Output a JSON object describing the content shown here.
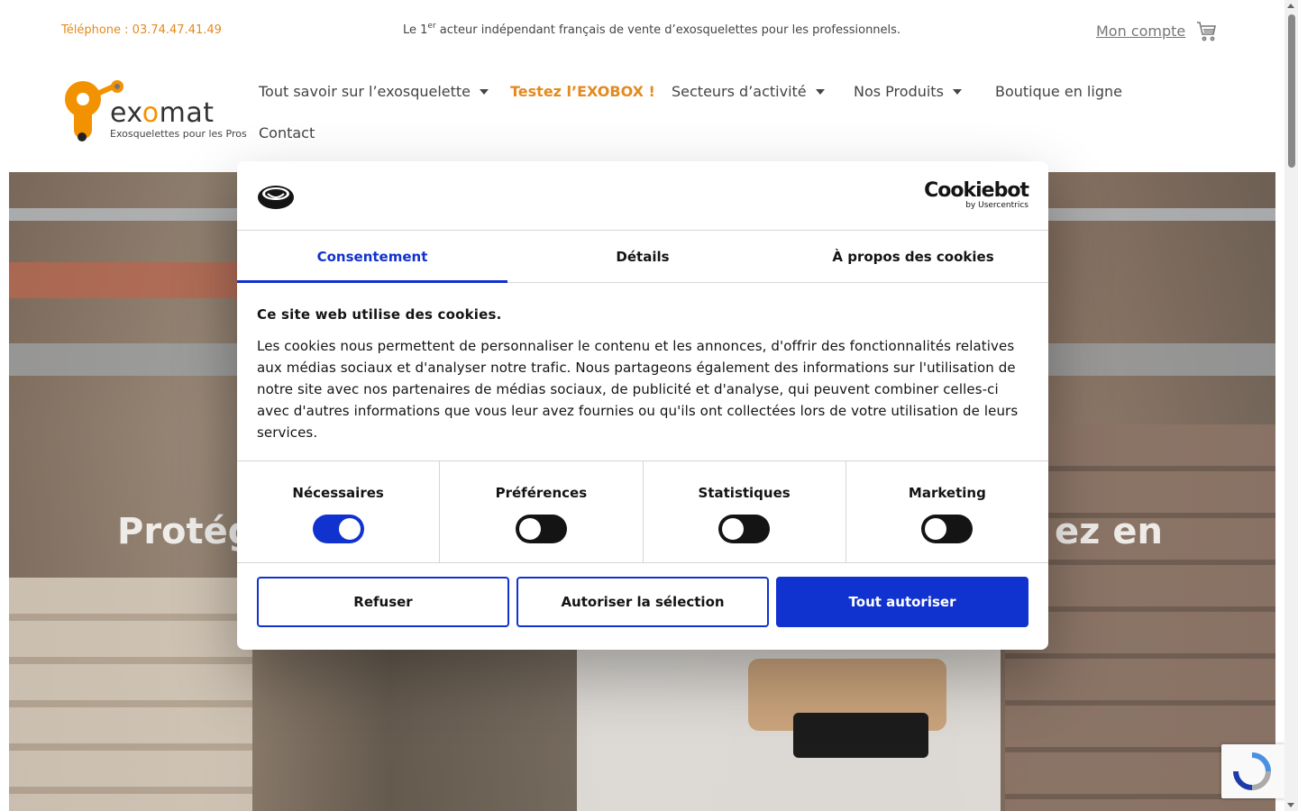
{
  "topbar": {
    "phone": "Téléphone : 03.74.47.41.49",
    "tagline_prefix": "Le 1",
    "tagline_sup": "er",
    "tagline_rest": " acteur indépendant français de vente d’exosquelettes pour les professionnels.",
    "account": "Mon compte",
    "cart_icon": "shopping-cart-icon"
  },
  "logo": {
    "word_ex": "ex",
    "word_o": "o",
    "word_mat": "mat",
    "subtitle": "Exosquelettes pour les Pros"
  },
  "nav": {
    "items": [
      {
        "label": "Tout savoir sur l’exosquelette",
        "has_dropdown": true
      },
      {
        "label": "Testez l’EXOBOX !",
        "has_dropdown": false
      },
      {
        "label": "Secteurs d’activité",
        "has_dropdown": true
      },
      {
        "label": "Nos Produits",
        "has_dropdown": true
      },
      {
        "label": "Boutique en ligne",
        "has_dropdown": false
      },
      {
        "label": "Contact",
        "has_dropdown": false
      }
    ]
  },
  "hero": {
    "text_left": "Protég",
    "text_right": "ez en"
  },
  "cookie": {
    "brand": "Cookiebot",
    "brand_sub": "by Usercentrics",
    "tabs": [
      "Consentement",
      "Détails",
      "À propos des cookies"
    ],
    "active_tab": "Consentement",
    "title": "Ce site web utilise des cookies.",
    "text": "Les cookies nous permettent de personnaliser le contenu et les annonces, d'offrir des fonctionnalités relatives aux médias sociaux et d'analyser notre trafic. Nous partageons également des informations sur l'utilisation de notre site avec nos partenaires de médias sociaux, de publicité et d'analyse, qui peuvent combiner celles-ci avec d'autres informations que vous leur avez fournies ou qu'ils ont collectées lors de votre utilisation de leurs services.",
    "toggles": [
      {
        "label": "Nécessaires",
        "on": true
      },
      {
        "label": "Préférences",
        "on": false
      },
      {
        "label": "Statistiques",
        "on": false
      },
      {
        "label": "Marketing",
        "on": false
      }
    ],
    "buttons": {
      "refuse": "Refuser",
      "allow_selection": "Autoriser la sélection",
      "allow_all": "Tout autoriser"
    }
  },
  "colors": {
    "brand_orange": "#f39200",
    "cookiebot_blue": "#1032cf"
  }
}
